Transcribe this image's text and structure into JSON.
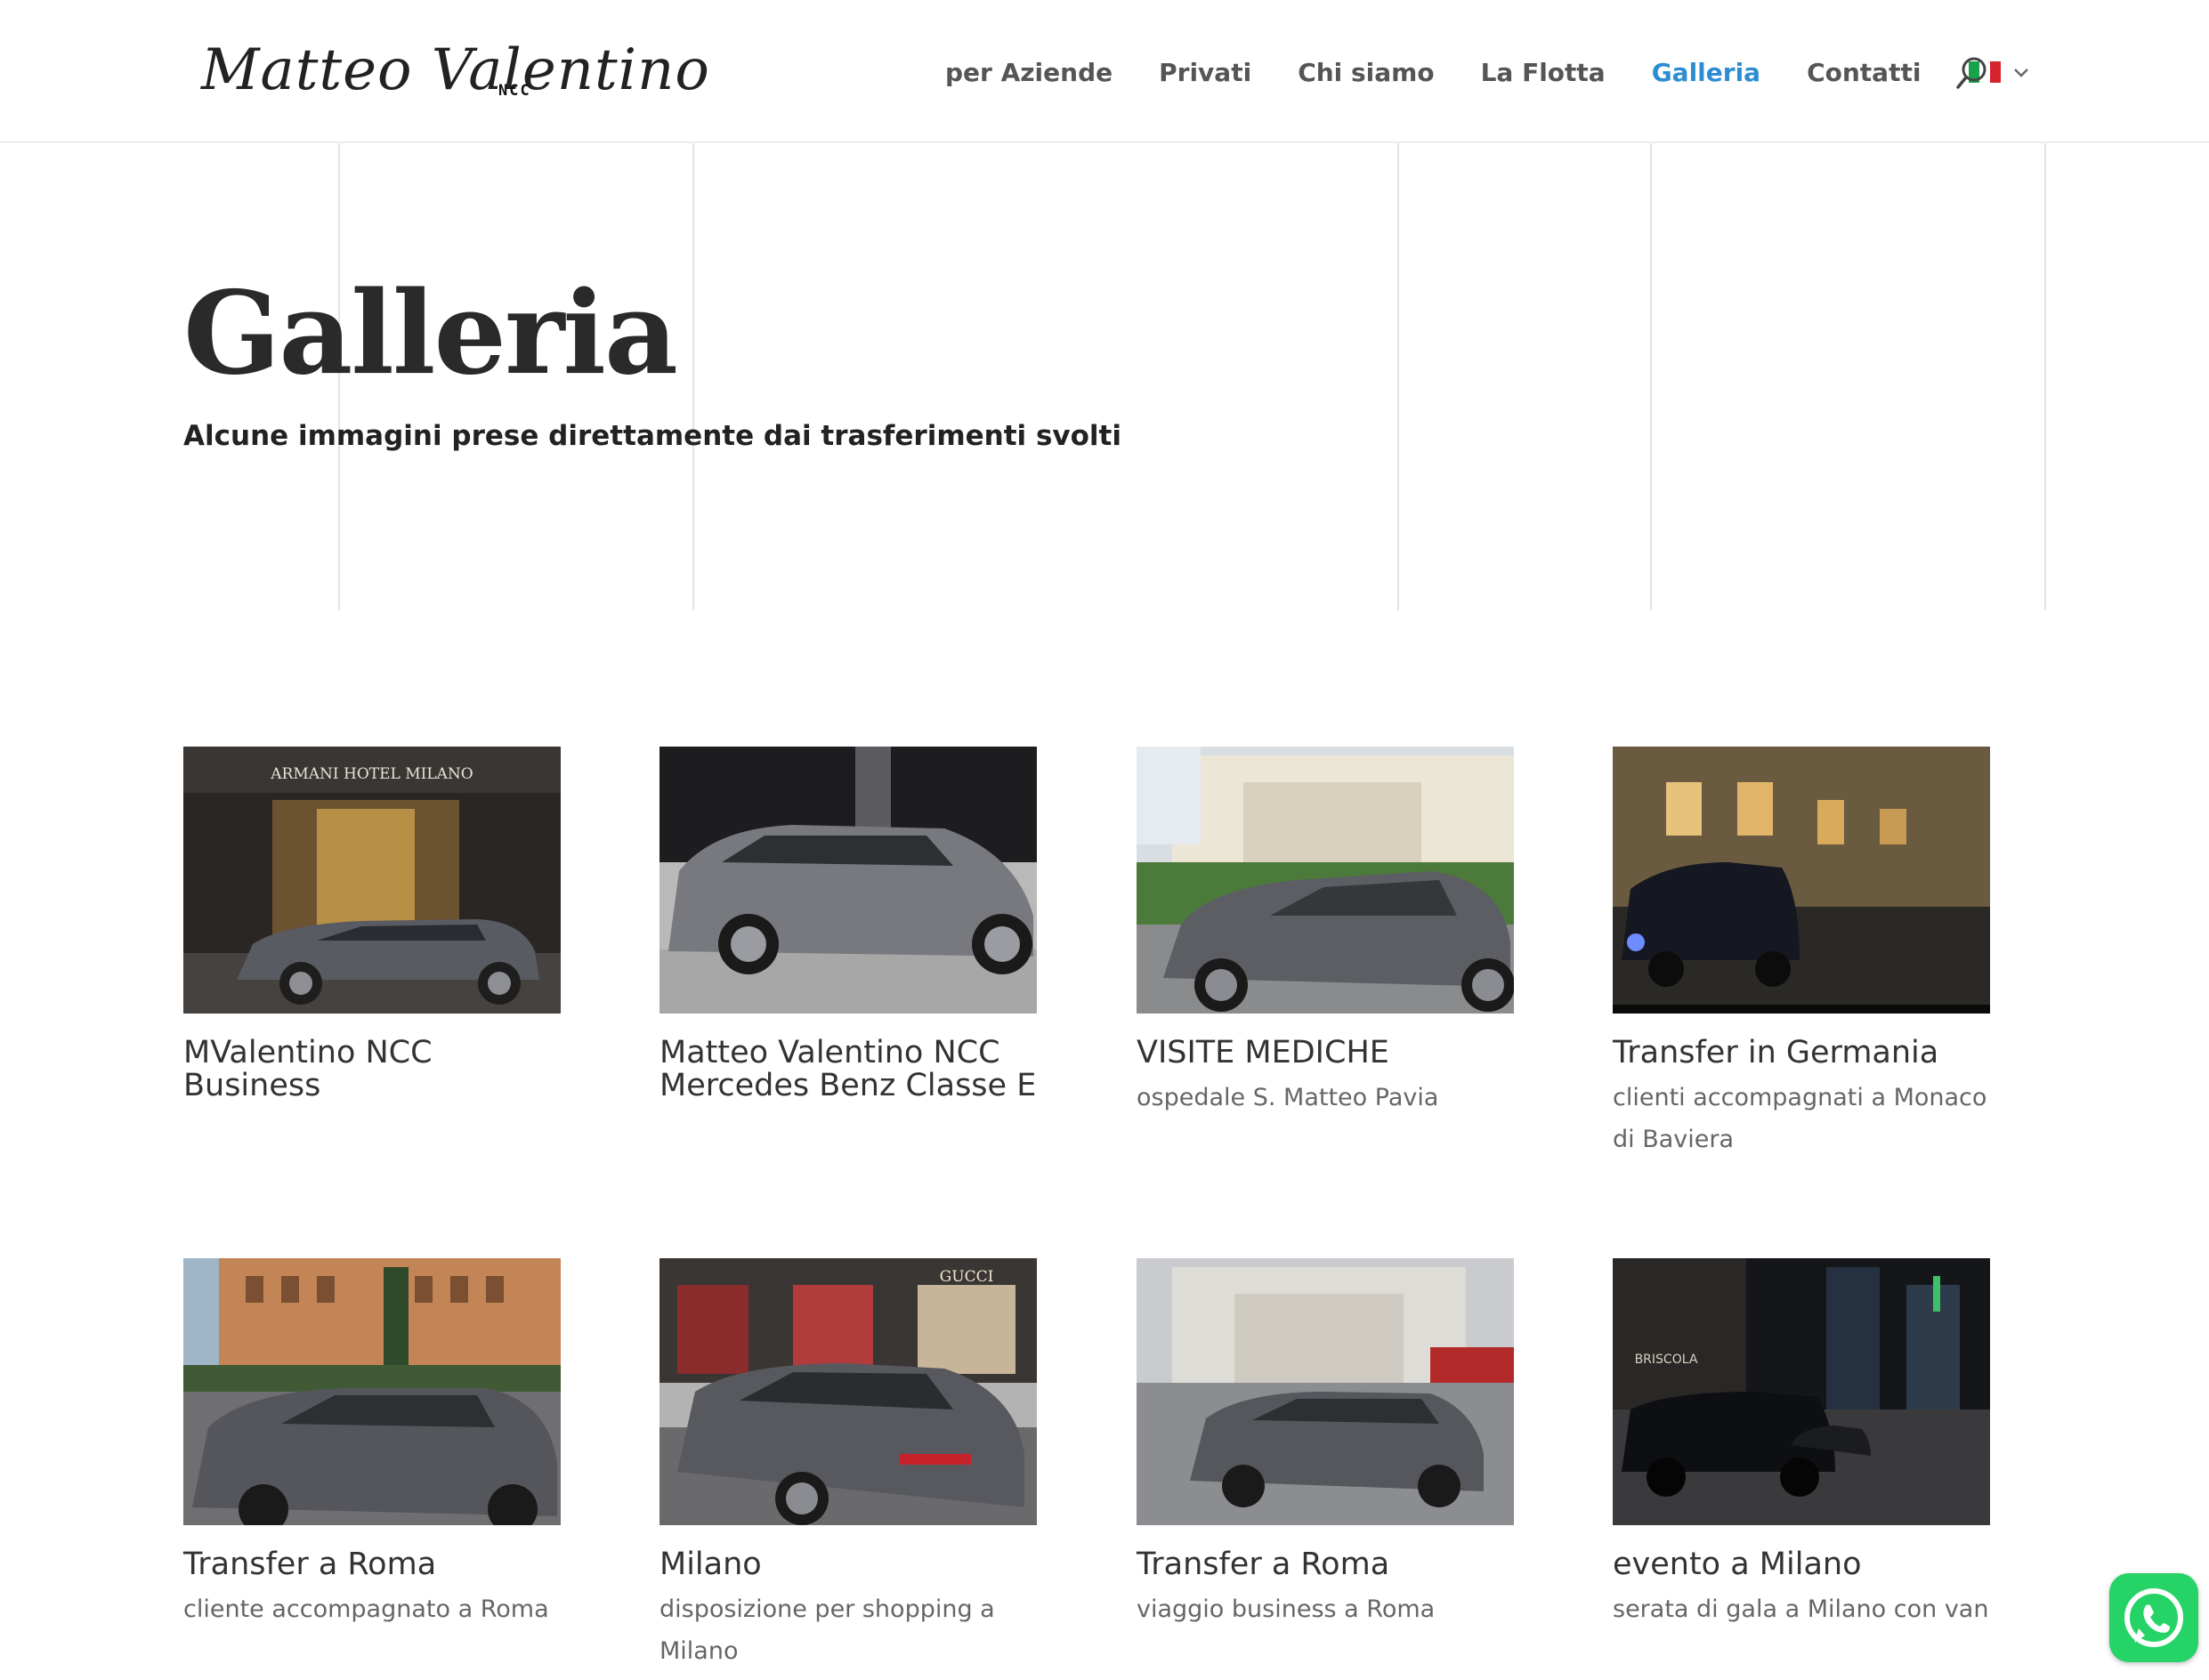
{
  "brand": {
    "logo_script": "Matteo Valentino",
    "logo_sub": "NCC"
  },
  "nav": {
    "items": [
      {
        "label": "per Aziende",
        "active": false
      },
      {
        "label": "Privati",
        "active": false
      },
      {
        "label": "Chi siamo",
        "active": false
      },
      {
        "label": "La Flotta",
        "active": false
      },
      {
        "label": "Galleria",
        "active": true
      },
      {
        "label": "Contatti",
        "active": false
      }
    ],
    "language_flag": "italy-flag-icon",
    "active_color": "#2d8dd2"
  },
  "hero": {
    "title": "Galleria",
    "subtitle": "Alcune immagini prese direttamente dai trasferimenti svolti"
  },
  "gallery": [
    {
      "title": "MValentino NCC Business",
      "caption": ""
    },
    {
      "title": "Matteo Valentino NCC Mercedes Benz Classe E",
      "caption": ""
    },
    {
      "title": "VISITE MEDICHE",
      "caption": "ospedale S. Matteo Pavia"
    },
    {
      "title": "Transfer in Germania",
      "caption": "clienti accompagnati a Monaco di Baviera"
    },
    {
      "title": "Transfer a Roma",
      "caption": "cliente accompagnato a Roma"
    },
    {
      "title": "Milano",
      "caption": "disposizione per shopping a Milano"
    },
    {
      "title": "Transfer a Roma",
      "caption": "viaggio business a Roma"
    },
    {
      "title": "evento a Milano",
      "caption": "serata di gala a Milano con van"
    }
  ],
  "photo_labels": {
    "armani": "ARMANI HOTEL MILANO",
    "gucci": "GUCCI",
    "briscola": "BRISCOLA"
  },
  "whatsapp": {
    "icon": "whatsapp-icon",
    "color": "#25d366"
  }
}
